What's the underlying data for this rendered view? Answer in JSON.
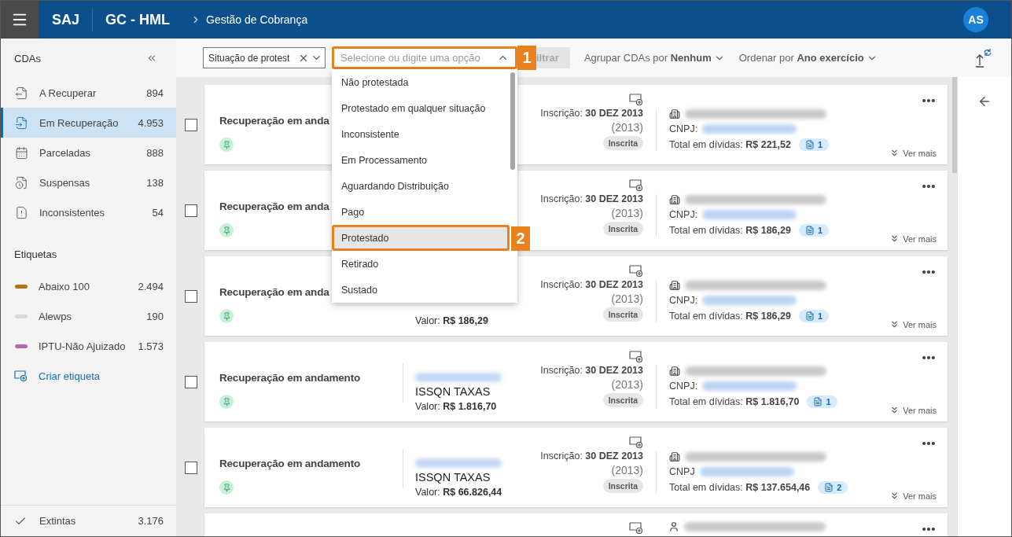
{
  "header": {
    "app": "SAJ",
    "environment": "GC - HML",
    "breadcrumb": "Gestão de Cobrança",
    "avatar": "AS"
  },
  "sidebar": {
    "title": "CDAs",
    "items": [
      {
        "label": "A Recuperar",
        "count": "894",
        "selected": false
      },
      {
        "label": "Em Recuperação",
        "count": "4.953",
        "selected": true
      },
      {
        "label": "Parceladas",
        "count": "888",
        "selected": false
      },
      {
        "label": "Suspensas",
        "count": "138",
        "selected": false
      },
      {
        "label": "Inconsistentes",
        "count": "54",
        "selected": false
      }
    ],
    "tags_title": "Etiquetas",
    "tags": [
      {
        "label": "Abaixo 100",
        "count": "2.494",
        "color": "#b8740c"
      },
      {
        "label": "Alewps",
        "count": "190",
        "color": "#d9d9d9"
      },
      {
        "label": "IPTU-Não Ajuizado",
        "count": "1.573",
        "color": "#b86aa8"
      }
    ],
    "create_tag": "Criar etiqueta",
    "footer": {
      "label": "Extintas",
      "count": "3.176"
    }
  },
  "toolbar": {
    "filter_chip": "Situação de protest",
    "combo": {
      "placeholder": "Selecione ou digite uma opção",
      "expanded": true,
      "callout": "1"
    },
    "filter_button": {
      "label": "iltrar",
      "disabled": true
    },
    "group_by": "Agrupar CDAs por **Nenhum**",
    "sort_by": "Ordenar por **Ano exercício**"
  },
  "dropdown": [
    {
      "label": "Não protestada",
      "selected": false
    },
    {
      "label": "Protestado em qualquer situação",
      "selected": false
    },
    {
      "label": "Inconsistente",
      "selected": false
    },
    {
      "label": "Em Processamento",
      "selected": false
    },
    {
      "label": "Aguardando Distribuição",
      "selected": false
    },
    {
      "label": "Pago",
      "selected": false
    },
    {
      "label": "Protestado",
      "selected": true,
      "callout": "2"
    },
    {
      "label": "Retirado",
      "selected": false
    },
    {
      "label": "Sustado",
      "selected": false
    }
  ],
  "cards": [
    {
      "kind": "company",
      "checked": false,
      "title": "Recuperação em anda",
      "registration": "Inscrição: **30 DEZ 2013**",
      "year": "(2013)",
      "badge": "Inscrita",
      "cnpj_label": "CNPJ:",
      "total": "Total em dívidas: **R$ 221,52**",
      "documents": "1",
      "more": "Ver mais"
    },
    {
      "kind": "company",
      "checked": false,
      "title": "Recuperação em anda",
      "registration": "Inscrição: **30 DEZ 2013**",
      "year": "(2013)",
      "badge": "Inscrita",
      "cnpj_label": "CNPJ:",
      "total": "Total em dívidas: **R$ 186,29**",
      "documents": "1",
      "more": "Ver mais"
    },
    {
      "kind": "company",
      "checked": false,
      "title": "Recuperação em anda",
      "value": "Valor: **R$ 186,29**",
      "registration": "Inscrição: **30 DEZ 2013**",
      "year": "(2013)",
      "badge": "Inscrita",
      "cnpj_label": "CNPJ:",
      "total": "Total em dívidas: **R$ 186,29**",
      "documents": "1",
      "more": "Ver mais"
    },
    {
      "kind": "company",
      "checked": false,
      "title": "Recuperação em andamento",
      "tax": "ISSQN TAXAS",
      "value": "Valor: **R$ 1.816,70**",
      "registration": "Inscrição: **30 DEZ 2013**",
      "year": "(2013)",
      "badge": "Inscrita",
      "cnpj_label": "CNPJ:",
      "total": "Total em dívidas: **R$ 1.816,70**",
      "documents": "1",
      "more": "Ver mais"
    },
    {
      "kind": "company",
      "checked": false,
      "title": "Recuperação em andamento",
      "tax": "ISSQN TAXAS",
      "value": "Valor: **R$ 66.826,44**",
      "registration": "Inscrição: **30 DEZ 2013**",
      "year": "(2013)",
      "badge": "Inscrita",
      "cnpj_label": "CNPJ",
      "total": "Total em dívidas: **R$ 137.654,46**",
      "documents": "2",
      "more": "Ver mais"
    },
    {
      "kind": "person"
    }
  ]
}
